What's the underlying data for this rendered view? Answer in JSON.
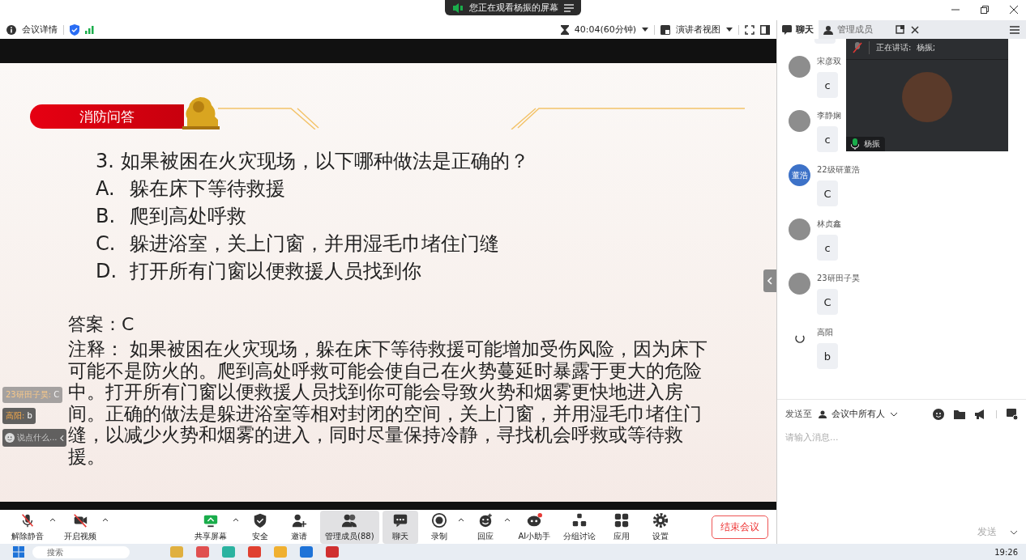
{
  "title_bar": {
    "notice": "您正在观看杨振的屏幕"
  },
  "meeting_bar": {
    "info": "会议详情",
    "timer": "40:04(60分钟)",
    "view": "演讲者视图"
  },
  "slide": {
    "banner": "消防问答",
    "question": "3. 如果被困在火灾现场，以下哪种做法是正确的？",
    "options": [
      {
        "letter": "A.",
        "text": "躲在床下等待救援"
      },
      {
        "letter": "B.",
        "text": "爬到高处呼救"
      },
      {
        "letter": "C.",
        "text": "躲进浴室，关上门窗，并用湿毛巾堵住门缝"
      },
      {
        "letter": "D.",
        "text": "打开所有门窗以便救援人员找到你"
      }
    ],
    "answer": "答案：C",
    "note": "注释： 如果被困在火灾现场，躲在床下等待救援可能增加受伤风险，因为床下可能不是防火的。爬到高处呼救可能会使自己在火势蔓延时暴露于更大的危险中。打开所有门窗以便救援人员找到你可能会导致火势和烟雾更快地进入房间。正确的做法是躲进浴室等相对封闭的空间，关上门窗，并用湿毛巾堵住门缝，以减少火势和烟雾的进入，同时尽量保持冷静，寻找机会呼救或等待救援。"
  },
  "live_chat": {
    "messages": [
      {
        "name": "23研田子昊:",
        "text": "C",
        "faded": true
      },
      {
        "name": "高阳:",
        "text": "b",
        "faded": false
      }
    ],
    "placeholder": "说点什么..."
  },
  "toolbar": {
    "left": [
      {
        "label": "解除静音",
        "kind": "mic-off",
        "menu": true,
        "selected": false
      },
      {
        "label": "开启视频",
        "kind": "video-off",
        "menu": true,
        "selected": false
      }
    ],
    "center": [
      {
        "label": "共享屏幕",
        "kind": "share",
        "menu": true,
        "selected": false
      },
      {
        "label": "安全",
        "kind": "shield",
        "menu": false,
        "selected": false
      },
      {
        "label": "邀请",
        "kind": "invite",
        "menu": false,
        "selected": false
      },
      {
        "label": "管理成员(88)",
        "kind": "members",
        "menu": false,
        "selected": true
      },
      {
        "label": "聊天",
        "kind": "chat",
        "menu": false,
        "selected": true
      },
      {
        "label": "录制",
        "kind": "record",
        "menu": true,
        "selected": false
      },
      {
        "label": "回应",
        "kind": "react",
        "menu": true,
        "selected": false
      },
      {
        "label": "AI小助手",
        "kind": "ai",
        "menu": false,
        "selected": false
      },
      {
        "label": "分组讨论",
        "kind": "breakout",
        "menu": false,
        "selected": false
      },
      {
        "label": "应用",
        "kind": "apps",
        "menu": false,
        "selected": false
      },
      {
        "label": "设置",
        "kind": "settings",
        "menu": false,
        "selected": false
      }
    ],
    "end_button": "结束会议"
  },
  "side_panel": {
    "tabs": [
      {
        "label": "聊天",
        "selected": true
      },
      {
        "label": "管理成员",
        "selected": false
      }
    ],
    "messages": [
      {
        "name": "宋彦双",
        "text": "c",
        "kind": "photo"
      },
      {
        "name": "李静娴",
        "text": "c",
        "kind": "photo"
      },
      {
        "name": "22级研董浩",
        "text": "C",
        "kind": "initials",
        "avatar_text": "董浩"
      },
      {
        "name": "林贞鑫",
        "text": "c",
        "kind": "photo"
      },
      {
        "name": "23研田子昊",
        "text": "C",
        "kind": "photo"
      },
      {
        "name": "高阳",
        "text": "b",
        "kind": "loading"
      }
    ],
    "video": {
      "speaking": "正在讲话:  杨振;",
      "name": "杨振"
    },
    "compose": {
      "send_to": "发送至",
      "recipient": "会议中所有人",
      "placeholder": "请输入消息...",
      "send": "发送"
    }
  },
  "taskbar": {
    "search": "搜索",
    "time": "19:26"
  }
}
